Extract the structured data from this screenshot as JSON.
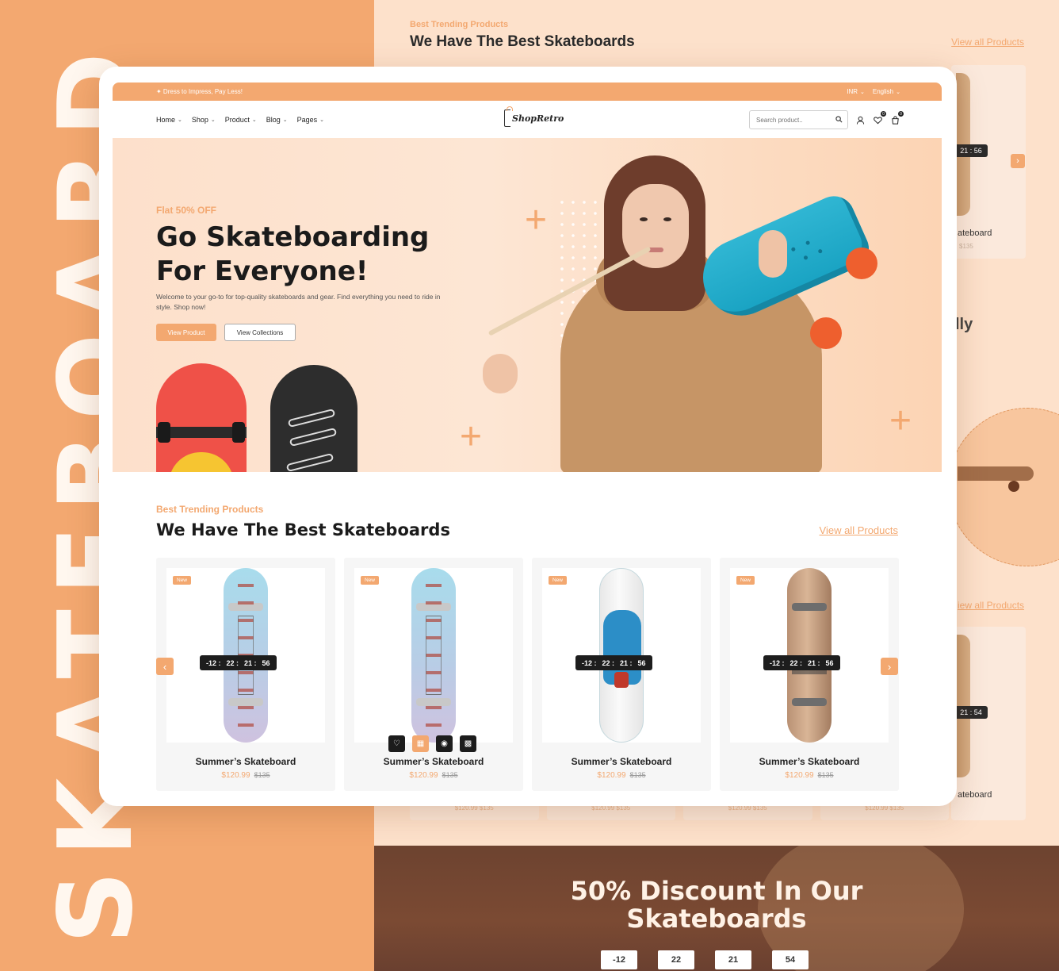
{
  "background": {
    "vertical_word": "SKATEBOARD",
    "section_kicker": "Best Trending Products",
    "section_title": "We Have The Best Skateboards",
    "view_all": "View all Products",
    "partial_card_name": "ateboard",
    "partial_card_price": "$135",
    "partial_timer_top": "21 :  56",
    "partial_timer_bottom": "21 :  54",
    "partial_heading": "lly",
    "partial_view_all": "iew all Products",
    "under_cards_prices": [
      "$120.99  $135",
      "$120.99  $135",
      "$120.99  $135",
      "$120.99  $135"
    ],
    "promo_title_line1": "50% Discount In Our",
    "promo_title_line2": "Skateboards",
    "promo_timer": [
      "-12",
      "22",
      "21",
      "54"
    ]
  },
  "topbar": {
    "promo": "✦ Dress to Impress, Pay Less!",
    "currency": "INR",
    "language": "English"
  },
  "nav": {
    "menu": [
      {
        "label": "Home"
      },
      {
        "label": "Shop"
      },
      {
        "label": "Product"
      },
      {
        "label": "Blog"
      },
      {
        "label": "Pages"
      }
    ],
    "logo": "ShopRetro",
    "search_placeholder": "Search product..",
    "wishlist_count": "0",
    "cart_count": "0"
  },
  "hero": {
    "kicker": "Flat 50% OFF",
    "title_line1": "Go Skateboarding",
    "title_line2": "For Everyone!",
    "description": "Welcome to your go-to for top-quality skateboards and gear. Find everything you need to ride in style. Shop now!",
    "primary_button": "View Product",
    "secondary_button": "View Collections"
  },
  "products": {
    "kicker": "Best Trending Products",
    "title": "We Have The Best Skateboards",
    "view_all": "View all Products",
    "items": [
      {
        "badge": "New",
        "name": "Summer’s Skateboard",
        "price": "$120.99",
        "old_price": "$135",
        "timer": [
          "-12 :",
          "22 :",
          "21 :",
          "56"
        ],
        "deck": "aqua"
      },
      {
        "badge": "New",
        "name": "Summer’s Skateboard",
        "price": "$120.99",
        "old_price": "$135",
        "timer": null,
        "deck": "aqua"
      },
      {
        "badge": "New",
        "name": "Summer’s Skateboard",
        "price": "$120.99",
        "old_price": "$135",
        "timer": [
          "-12 :",
          "22 :",
          "21 :",
          "56"
        ],
        "deck": "white"
      },
      {
        "badge": "New",
        "name": "Summer’s Skateboard",
        "price": "$120.99",
        "old_price": "$135",
        "timer": [
          "-12 :",
          "22 :",
          "21 :",
          "56"
        ],
        "deck": "wood"
      }
    ],
    "quick_actions": [
      "heart-icon",
      "cart-icon",
      "eye-icon",
      "trash-icon"
    ]
  },
  "colors": {
    "accent": "#f3a870",
    "hero_bg": "#fde0cb",
    "dark": "#1d1d1d"
  }
}
